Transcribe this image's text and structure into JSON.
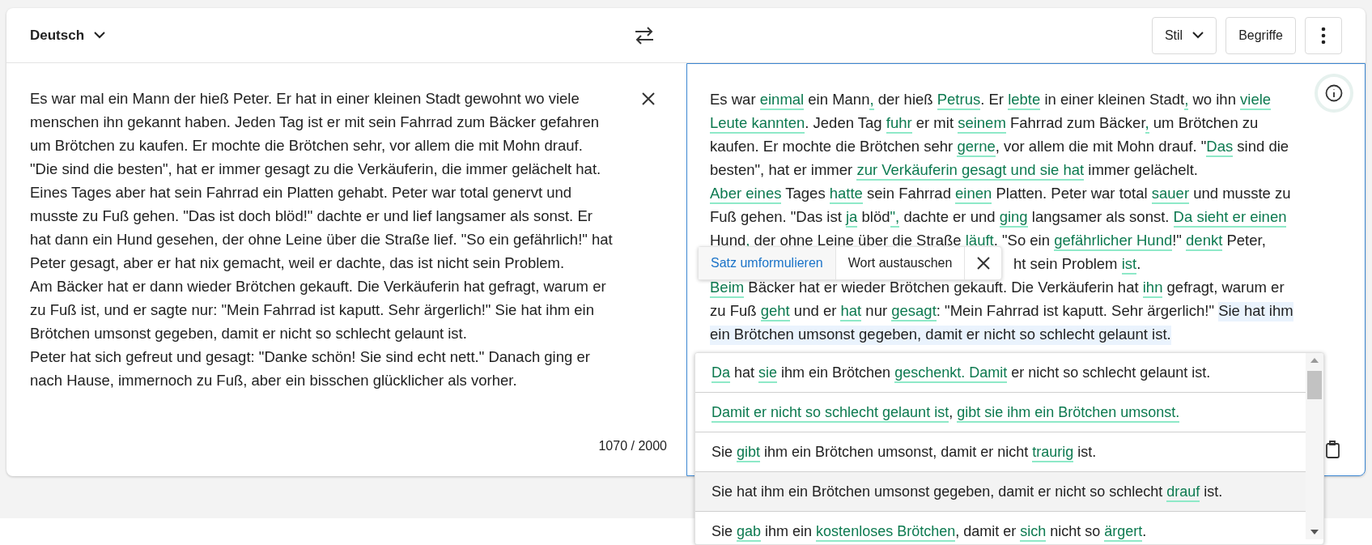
{
  "header": {
    "language": "Deutsch",
    "buttons": [
      {
        "label": "Stil",
        "kind": "dropdown"
      },
      {
        "label": "Begriffe",
        "kind": "plain"
      }
    ]
  },
  "source": {
    "lines": [
      "Es war mal ein Mann der hieß Peter. Er hat in einer kleinen Stadt gewohnt wo viele",
      "menschen ihn gekannt haben. Jeden Tag ist er mit sein Fahrrad zum Bäcker gefahren",
      "um Brötchen zu kaufen. Er mochte die Brötchen sehr, vor allem die mit Mohn drauf.",
      "\"Die sind die besten\", hat er immer gesagt zu die Verkäuferin, die immer gelächelt hat.",
      "Eines Tages aber hat sein Fahrrad ein Platten gehabt. Peter war total genervt und",
      "musste zu Fuß gehen. \"Das ist doch blöd!\" dachte er und lief langsamer als sonst. Er",
      "hat dann ein Hund gesehen, der ohne Leine über die Straße lief. \"So ein gefährlich!\" hat",
      "Peter gesagt, aber er hat nix gemacht, weil er dachte, das ist nicht sein Problem.",
      "Am Bäcker hat er dann wieder Brötchen gekauft. Die Verkäuferin hat gefragt, warum er",
      "zu Fuß ist, und er sagte nur: \"Mein Fahrrad ist kaputt. Sehr ärgerlich!\" Sie hat ihm ein",
      "Brötchen umsonst gegeben, damit er nicht so schlecht gelaunt ist.",
      "Peter hat sich gefreut und gesagt: \"Danke schön! Sie sind echt nett.\" Danach ging er",
      "nach Hause, immernoch zu Fuß, aber ein bisschen glücklicher als vorher."
    ],
    "counter": "1070 / 2000"
  },
  "result": {
    "lines": [
      {
        "kind": "full",
        "segments": [
          {
            "text": "Es war ",
            "changed": false,
            "selected": false
          },
          {
            "text": "einmal",
            "changed": true,
            "selected": false
          },
          {
            "text": " ein Mann",
            "changed": false,
            "selected": false
          },
          {
            "text": ",",
            "changed": true,
            "selected": false
          },
          {
            "text": " der hieß ",
            "changed": false,
            "selected": false
          },
          {
            "text": "Petrus",
            "changed": true,
            "selected": false
          },
          {
            "text": ". Er ",
            "changed": false,
            "selected": false
          },
          {
            "text": "lebte",
            "changed": true,
            "selected": false
          },
          {
            "text": " in einer kleinen Stadt",
            "changed": false,
            "selected": false
          },
          {
            "text": ",",
            "changed": true,
            "selected": false
          },
          {
            "text": " wo ihn ",
            "changed": false,
            "selected": false
          },
          {
            "text": "viele",
            "changed": true,
            "selected": false
          }
        ]
      },
      {
        "kind": "full",
        "segments": [
          {
            "text": "Leute kannten",
            "changed": true,
            "selected": false
          },
          {
            "text": ". Jeden Tag ",
            "changed": false,
            "selected": false
          },
          {
            "text": "fuhr",
            "changed": true,
            "selected": false
          },
          {
            "text": " er mit ",
            "changed": false,
            "selected": false
          },
          {
            "text": "seinem",
            "changed": true,
            "selected": false
          },
          {
            "text": " Fahrrad zum Bäcker",
            "changed": false,
            "selected": false
          },
          {
            "text": ",",
            "changed": true,
            "selected": false
          },
          {
            "text": " um Brötchen zu",
            "changed": false,
            "selected": false
          }
        ]
      },
      {
        "kind": "full",
        "segments": [
          {
            "text": "kaufen. Er mochte die Brötchen sehr ",
            "changed": false,
            "selected": false
          },
          {
            "text": "gerne",
            "changed": true,
            "selected": false
          },
          {
            "text": ", vor allem die mit Mohn drauf. \"",
            "changed": false,
            "selected": false
          },
          {
            "text": "Das",
            "changed": true,
            "selected": false
          },
          {
            "text": " sind die",
            "changed": false,
            "selected": false
          }
        ]
      },
      {
        "kind": "full",
        "segments": [
          {
            "text": "besten\", hat er immer ",
            "changed": false,
            "selected": false
          },
          {
            "text": "zur Verkäuferin gesagt und sie hat",
            "changed": true,
            "selected": false
          },
          {
            "text": " immer gelächelt.",
            "changed": false,
            "selected": false
          }
        ]
      },
      {
        "kind": "full",
        "segments": [
          {
            "text": "Aber eines",
            "changed": true,
            "selected": false
          },
          {
            "text": " Tages ",
            "changed": false,
            "selected": false
          },
          {
            "text": "hatte",
            "changed": true,
            "selected": false
          },
          {
            "text": " sein Fahrrad ",
            "changed": false,
            "selected": false
          },
          {
            "text": "einen",
            "changed": true,
            "selected": false
          },
          {
            "text": " Platten. Peter war total ",
            "changed": false,
            "selected": false
          },
          {
            "text": "sauer",
            "changed": true,
            "selected": false
          },
          {
            "text": " und musste zu",
            "changed": false,
            "selected": false
          }
        ]
      },
      {
        "kind": "full",
        "segments": [
          {
            "text": "Fuß gehen. \"Das ist ",
            "changed": false,
            "selected": false
          },
          {
            "text": "ja",
            "changed": true,
            "selected": false
          },
          {
            "text": " blöd",
            "changed": false,
            "selected": false
          },
          {
            "text": "\",",
            "changed": true,
            "selected": false
          },
          {
            "text": " dachte er und ",
            "changed": false,
            "selected": false
          },
          {
            "text": "ging",
            "changed": true,
            "selected": false
          },
          {
            "text": " langsamer als sonst. ",
            "changed": false,
            "selected": false
          },
          {
            "text": "Da sieht er einen",
            "changed": true,
            "selected": false
          }
        ]
      },
      {
        "kind": "full",
        "segments": [
          {
            "text": "Hund",
            "changed": false,
            "selected": false
          },
          {
            "text": ",",
            "changed": true,
            "selected": false
          },
          {
            "text": " der ohne Leine über die Straße ",
            "changed": false,
            "selected": false
          },
          {
            "text": "läuft",
            "changed": true,
            "selected": false
          },
          {
            "text": ". \"So ein ",
            "changed": false,
            "selected": false
          },
          {
            "text": "gefährlicher Hund",
            "changed": true,
            "selected": false
          },
          {
            "text": "!\" ",
            "changed": false,
            "selected": false
          },
          {
            "text": "denkt",
            "changed": true,
            "selected": false
          },
          {
            "text": " Peter,",
            "changed": false,
            "selected": false
          }
        ]
      },
      {
        "kind": "covered",
        "segments": [
          {
            "text": "ht sein Problem ",
            "changed": false,
            "selected": false
          },
          {
            "text": "ist",
            "changed": true,
            "selected": false
          },
          {
            "text": ".",
            "changed": false,
            "selected": false
          }
        ]
      },
      {
        "kind": "full",
        "segments": [
          {
            "text": "Beim",
            "changed": true,
            "selected": false
          },
          {
            "text": " Bäcker hat er wieder Brötchen gekauft. Die Verkäuferin hat ",
            "changed": false,
            "selected": false
          },
          {
            "text": "ihn",
            "changed": true,
            "selected": false
          },
          {
            "text": " gefragt, warum er",
            "changed": false,
            "selected": false
          }
        ]
      },
      {
        "kind": "full",
        "segments": [
          {
            "text": "zu Fuß ",
            "changed": false,
            "selected": false
          },
          {
            "text": "geht",
            "changed": true,
            "selected": false
          },
          {
            "text": " und er ",
            "changed": false,
            "selected": false
          },
          {
            "text": "hat",
            "changed": true,
            "selected": false
          },
          {
            "text": " nur ",
            "changed": false,
            "selected": false
          },
          {
            "text": "gesagt",
            "changed": true,
            "selected": false
          },
          {
            "text": ": \"Mein Fahrrad ist kaputt. Sehr ärgerlich!\" ",
            "changed": false,
            "selected": false
          },
          {
            "text": "Sie hat ihm",
            "changed": false,
            "selected": true
          }
        ]
      },
      {
        "kind": "full",
        "segments": [
          {
            "text": "ein Brötchen umsonst gegeben, damit er nicht so schlecht gelaunt ist.",
            "changed": false,
            "selected": true
          }
        ]
      }
    ]
  },
  "popup": {
    "items": [
      {
        "label": "Satz umformulieren",
        "selected": true
      },
      {
        "label": "Wort austauschen",
        "selected": false
      }
    ]
  },
  "suggestions": [
    {
      "selected": false,
      "segments": [
        {
          "text": "Da",
          "changed": true
        },
        {
          "text": " hat ",
          "changed": false
        },
        {
          "text": "sie",
          "changed": true
        },
        {
          "text": " ihm ein Brötchen ",
          "changed": false
        },
        {
          "text": "geschenkt. ",
          "changed": true
        },
        {
          "text": "Damit",
          "changed": true
        },
        {
          "text": " er nicht so schlecht gelaunt ist.",
          "changed": false
        }
      ]
    },
    {
      "selected": false,
      "segments": [
        {
          "text": "Damit er nicht so schlecht gelaunt ist",
          "changed": true
        },
        {
          "text": ", ",
          "changed": false
        },
        {
          "text": "gibt sie ihm ein Brötchen umsonst.",
          "changed": true
        }
      ]
    },
    {
      "selected": false,
      "segments": [
        {
          "text": "Sie ",
          "changed": false
        },
        {
          "text": "gibt",
          "changed": true
        },
        {
          "text": " ihm ein Brötchen umsonst, damit er nicht ",
          "changed": false
        },
        {
          "text": "traurig",
          "changed": true
        },
        {
          "text": " ist.",
          "changed": false
        }
      ]
    },
    {
      "selected": true,
      "segments": [
        {
          "text": "Sie hat ihm ein Brötchen umsonst gegeben, damit er nicht so schlecht ",
          "changed": false
        },
        {
          "text": "drauf",
          "changed": true
        },
        {
          "text": " ist.",
          "changed": false
        }
      ]
    },
    {
      "selected": false,
      "segments": [
        {
          "text": "Sie ",
          "changed": false
        },
        {
          "text": "gab",
          "changed": true
        },
        {
          "text": " ihm ein ",
          "changed": false
        },
        {
          "text": "kostenloses Brötchen",
          "changed": true
        },
        {
          "text": ", damit er ",
          "changed": false
        },
        {
          "text": "sich",
          "changed": true
        },
        {
          "text": " nicht so ",
          "changed": false
        },
        {
          "text": "ärgert",
          "changed": true
        },
        {
          "text": ".",
          "changed": false
        }
      ]
    }
  ]
}
